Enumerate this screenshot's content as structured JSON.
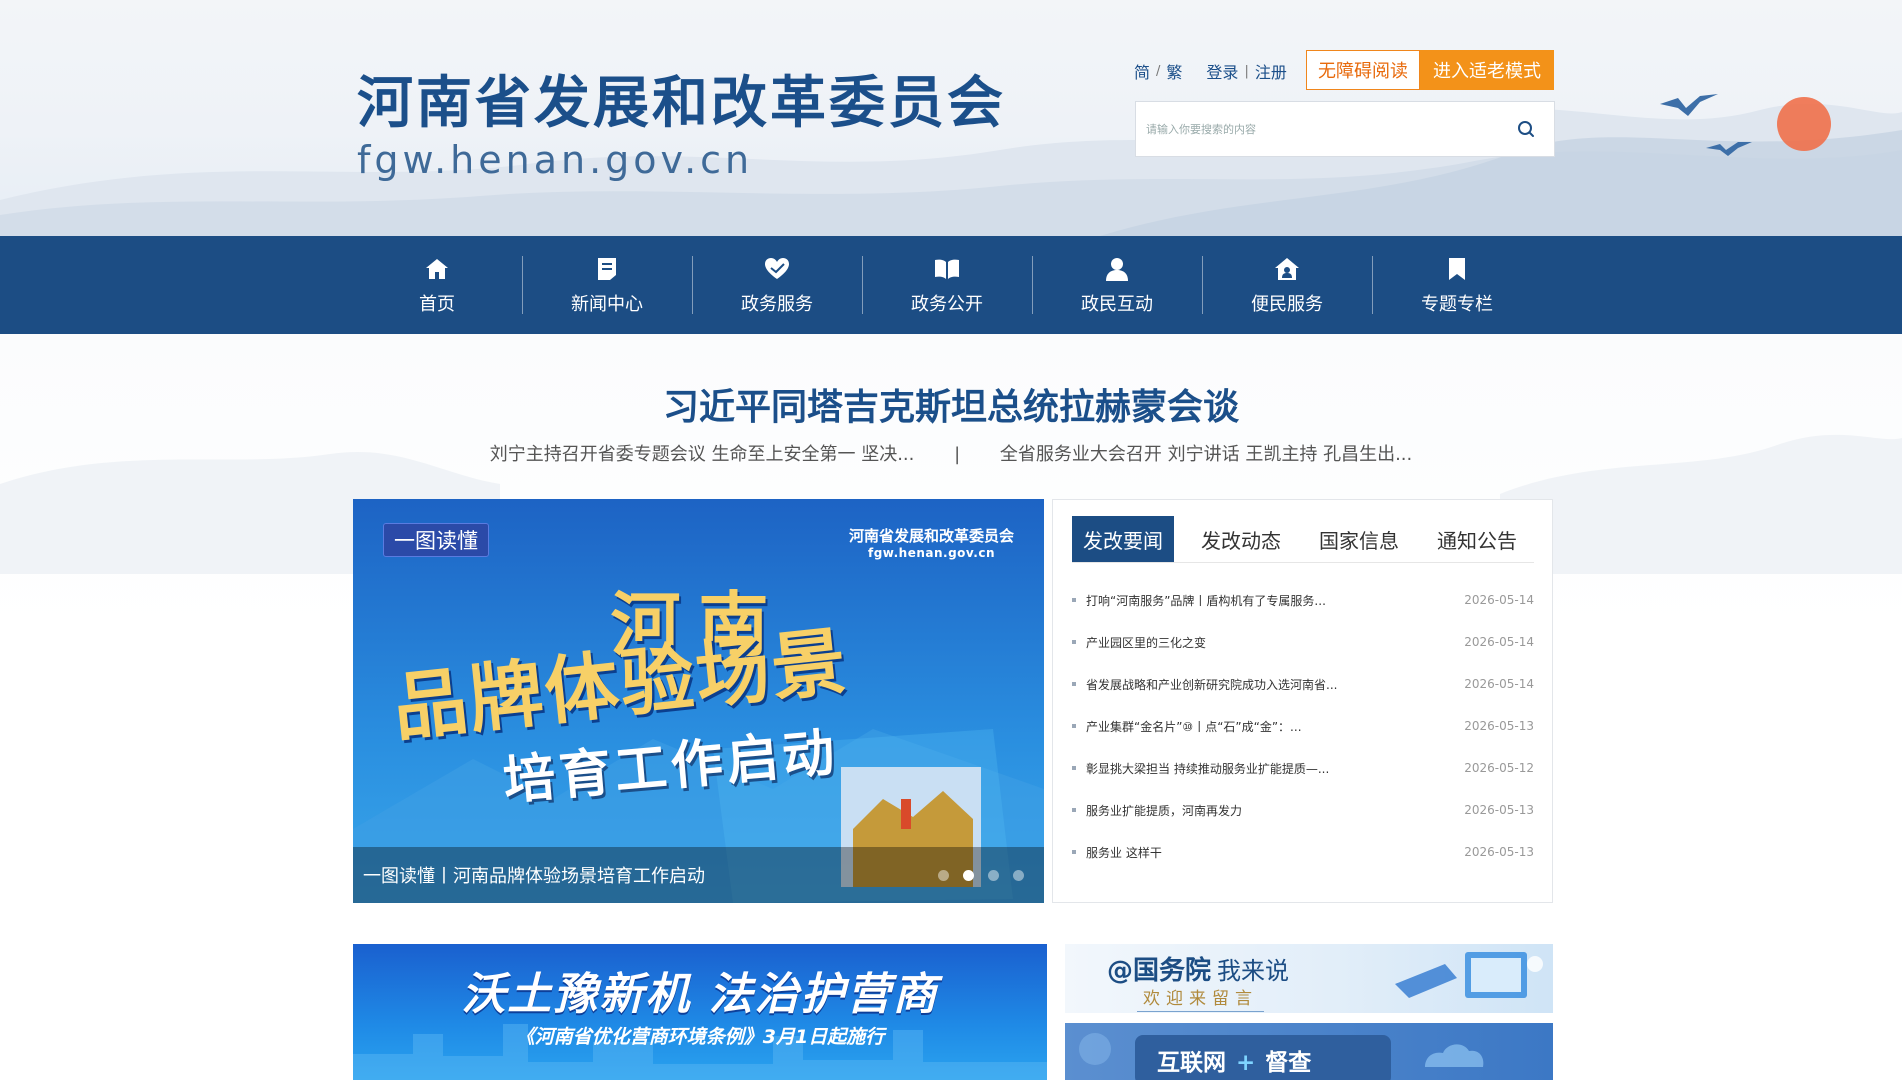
{
  "header": {
    "site_title": "河南省发展和改革委员会",
    "site_domain": "fgw.henan.gov.cn",
    "lang_simplified": "简",
    "lang_traditional": "繁",
    "login": "登录",
    "register": "注册",
    "accessible_button": "无障碍阅读",
    "elder_mode_button": "进入适老模式",
    "search_placeholder": "请输入你要搜索的内容"
  },
  "nav": {
    "items": [
      {
        "label": "首页",
        "icon": "home-icon"
      },
      {
        "label": "新闻中心",
        "icon": "document-icon"
      },
      {
        "label": "政务服务",
        "icon": "heart-hand-icon"
      },
      {
        "label": "政务公开",
        "icon": "book-icon"
      },
      {
        "label": "政民互动",
        "icon": "user-icon"
      },
      {
        "label": "便民服务",
        "icon": "house-people-icon"
      },
      {
        "label": "专题专栏",
        "icon": "bookmark-icon"
      }
    ]
  },
  "headline": {
    "main": "习近平同塔吉克斯坦总统拉赫蒙会谈",
    "sub_left": "刘宁主持召开省委专题会议 生命至上安全第一 坚决...",
    "sub_divider": "|",
    "sub_right": "全省服务业大会召开 刘宁讲话 王凯主持 孔昌生出..."
  },
  "banner": {
    "tag": "一图读懂",
    "org_name": "河南省发展和改革委员会",
    "org_domain": "fgw.henan.gov.cn",
    "line1": "河南",
    "line2": "品牌体验场景",
    "line3": "培育工作启动",
    "caption": "一图读懂丨河南品牌体验场景培育工作启动",
    "slide_count": 4,
    "active_slide": 2
  },
  "news": {
    "tabs": [
      {
        "label": "发改要闻",
        "active": true
      },
      {
        "label": "发改动态",
        "active": false
      },
      {
        "label": "国家信息",
        "active": false
      },
      {
        "label": "通知公告",
        "active": false
      }
    ],
    "items": [
      {
        "title": "打响“河南服务”品牌丨盾构机有了专属服务...",
        "date": "2026-05-14"
      },
      {
        "title": "产业园区里的三化之变",
        "date": "2026-05-14"
      },
      {
        "title": "省发展战略和产业创新研究院成功入选河南省...",
        "date": "2026-05-14"
      },
      {
        "title": "产业集群“金名片”⑩丨点“石”成“金”：...",
        "date": "2026-05-13"
      },
      {
        "title": "彰显挑大梁担当 持续推动服务业扩能提质—...",
        "date": "2026-05-12"
      },
      {
        "title": "服务业扩能提质，河南再发力",
        "date": "2026-05-13"
      },
      {
        "title": "服务业 这样干",
        "date": "2026-05-13"
      }
    ]
  },
  "ads": {
    "left_title": "沃土豫新机 法治护营商",
    "left_subtitle": "《河南省优化营商环境条例》3月1日起施行",
    "right1_bold": "@国务院",
    "right1_light": "我来说",
    "right1_sub": "欢迎来留言",
    "right2_part1": "互联网",
    "right2_plus": "+",
    "right2_part2": "督查"
  },
  "colors": {
    "primary_blue": "#1c4d84",
    "orange": "#f39219",
    "gold": "#f7d067"
  }
}
